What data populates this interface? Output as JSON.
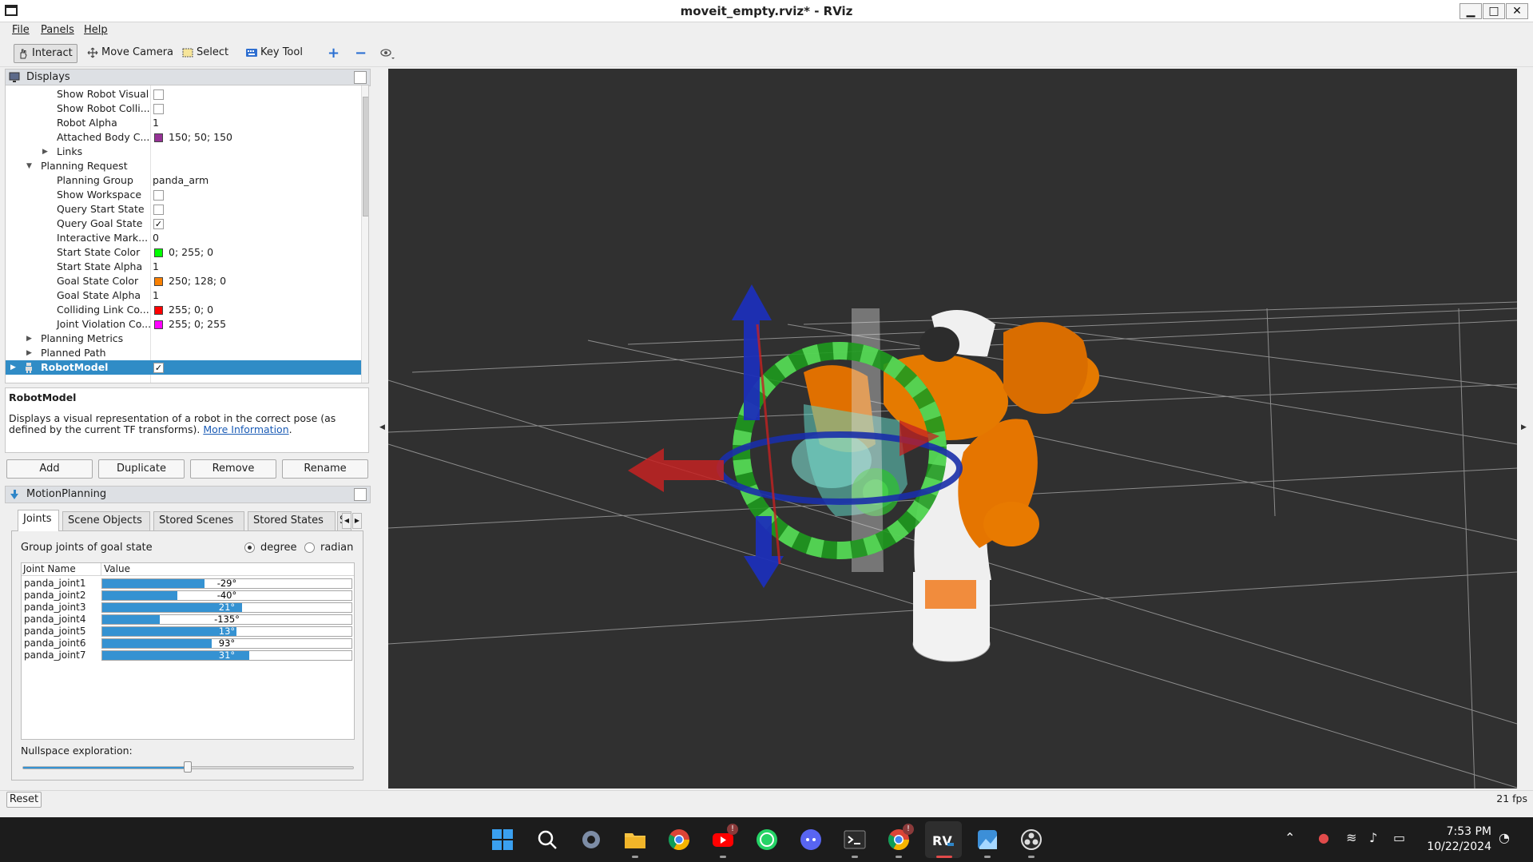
{
  "window": {
    "title": "moveit_empty.rviz* - RViz",
    "min": "▁",
    "max": "□",
    "close": "✕"
  },
  "menu": {
    "file": "File",
    "panels": "Panels",
    "help": "Help"
  },
  "toolbar": {
    "interact": "Interact",
    "move_camera": "Move Camera",
    "select": "Select",
    "key_tool": "Key Tool",
    "plus": "+",
    "minus": "−"
  },
  "displays": {
    "title": "Displays",
    "rows": [
      {
        "label": "Show Robot Visual",
        "checkbox": false
      },
      {
        "label": "Show Robot Colli...",
        "checkbox": false
      },
      {
        "label": "Robot Alpha",
        "value": "1"
      },
      {
        "label": "Attached Body C...",
        "value": "150; 50; 150",
        "color": "#963296"
      },
      {
        "label": "Links",
        "expandable": true
      },
      {
        "label": "Planning Request",
        "expanded": true
      },
      {
        "label": "Planning Group",
        "value": "panda_arm"
      },
      {
        "label": "Show Workspace",
        "checkbox": false
      },
      {
        "label": "Query Start State",
        "checkbox": false
      },
      {
        "label": "Query Goal State",
        "checkbox": true
      },
      {
        "label": "Interactive Mark...",
        "value": "0"
      },
      {
        "label": "Start State Color",
        "value": "0; 255; 0",
        "color": "#00ff00"
      },
      {
        "label": "Start State Alpha",
        "value": "1"
      },
      {
        "label": "Goal State Color",
        "value": "250; 128; 0",
        "color": "#fa8000"
      },
      {
        "label": "Goal State Alpha",
        "value": "1"
      },
      {
        "label": "Colliding Link Co...",
        "value": "255; 0; 0",
        "color": "#ff0000"
      },
      {
        "label": "Joint Violation Co...",
        "value": "255; 0; 255",
        "color": "#ff00ff"
      },
      {
        "label": "Planning Metrics",
        "expandable": true
      },
      {
        "label": "Planned Path",
        "expandable": true
      },
      {
        "label": "RobotModel",
        "checkbox": true,
        "selected": true
      }
    ]
  },
  "description": {
    "title": "RobotModel",
    "text": "Displays a visual representation of a robot in the correct pose (as defined by the current TF transforms).",
    "link": "More Information",
    "trail": "."
  },
  "display_buttons": {
    "add": "Add",
    "duplicate": "Duplicate",
    "remove": "Remove",
    "rename": "Rename"
  },
  "motion_planning": {
    "title": "MotionPlanning",
    "tabs": [
      "Joints",
      "Scene Objects",
      "Stored Scenes",
      "Stored States",
      "S"
    ],
    "group_label": "Group joints of goal state",
    "degree": "degree",
    "radian": "radian",
    "col_name": "Joint Name",
    "col_value": "Value",
    "joints": [
      {
        "name": "panda_joint1",
        "value": "-29°",
        "fill": 0.41
      },
      {
        "name": "panda_joint2",
        "value": "-40°",
        "fill": 0.3
      },
      {
        "name": "panda_joint3",
        "value": "21°",
        "fill": 0.56
      },
      {
        "name": "panda_joint4",
        "value": "-135°",
        "fill": 0.23
      },
      {
        "name": "panda_joint5",
        "value": "13°",
        "fill": 0.54
      },
      {
        "name": "panda_joint6",
        "value": "93°",
        "fill": 0.44
      },
      {
        "name": "panda_joint7",
        "value": "31°",
        "fill": 0.59
      }
    ],
    "nullspace_label": "Nullspace exploration:",
    "nullspace_value": 0.5
  },
  "status": {
    "reset": "Reset",
    "fps": "21 fps"
  },
  "taskbar": {
    "time": "7:53 PM",
    "date": "10/22/2024",
    "badge": "!"
  }
}
